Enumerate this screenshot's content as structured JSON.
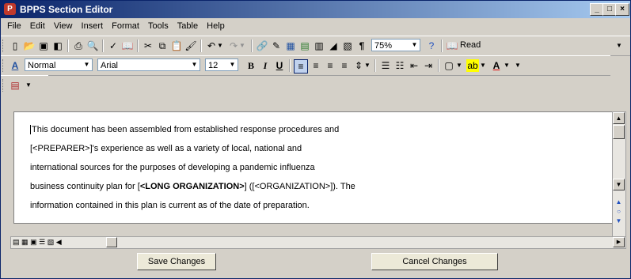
{
  "window": {
    "title": "BPPS Section Editor",
    "icon_letter": "P"
  },
  "menu": [
    {
      "label": "File"
    },
    {
      "label": "Edit"
    },
    {
      "label": "View"
    },
    {
      "label": "Insert"
    },
    {
      "label": "Format"
    },
    {
      "label": "Tools"
    },
    {
      "label": "Table"
    },
    {
      "label": "Help"
    }
  ],
  "toolbar_standard": {
    "zoom": "75%",
    "read_label": "Read"
  },
  "toolbar_format": {
    "style": "Normal",
    "font": "Arial",
    "size": "12"
  },
  "document": {
    "paragraph": [
      {
        "text": "This document has been assembled from established response procedures and"
      },
      {
        "text": "[<PREPARER>]'s experience as well as a variety of local, national and"
      },
      {
        "text": "international sources for the purposes of developing a pandemic influenza"
      },
      {
        "pre": "business continuity plan for [",
        "bold": "<LONG ORGANIZATION>",
        "post": "] ([<ORGANIZATION>]). The"
      },
      {
        "text": "information contained in this plan is current as of the date of preparation."
      }
    ]
  },
  "buttons": {
    "save": "Save Changes",
    "cancel": "Cancel Changes"
  }
}
